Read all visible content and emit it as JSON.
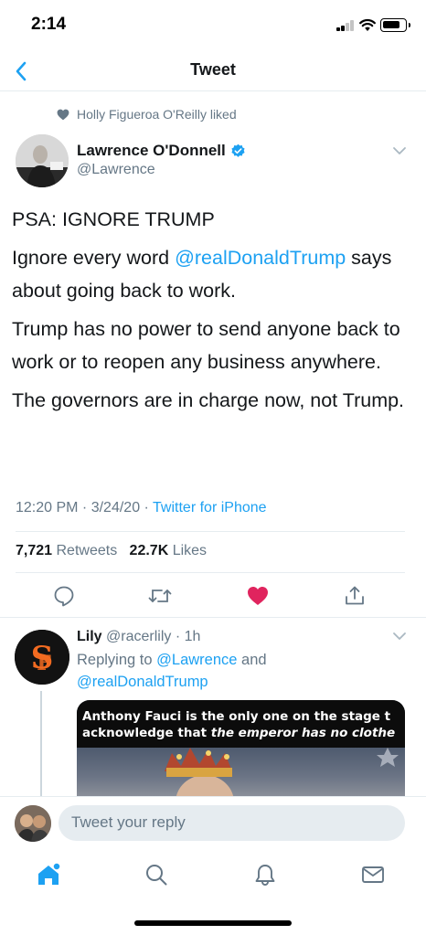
{
  "status_bar": {
    "time": "2:14"
  },
  "nav": {
    "title": "Tweet"
  },
  "social_context": {
    "text": "Holly Figueroa O'Reilly liked"
  },
  "tweet": {
    "author_name": "Lawrence O'Donnell",
    "author_handle": "@Lawrence",
    "paragraphs": {
      "p1": "PSA: IGNORE TRUMP",
      "p2_before": "Ignore every word ",
      "p2_mention": "@realDonaldTrump",
      "p2_after": " says about going back to work.",
      "p3": "Trump has no power to send anyone back to work or to reopen any business anywhere.",
      "p4": "The governors are in charge now, not Trump."
    },
    "time": "12:20 PM",
    "date": "3/24/20",
    "source": "Twitter for iPhone",
    "retweets_count": "7,721",
    "retweets_label": "Retweets",
    "likes_count": "22.7K",
    "likes_label": "Likes",
    "liked": true
  },
  "reply": {
    "name": "Lily",
    "handle": "@racerlily",
    "age": "1h",
    "replying_prefix": "Replying to ",
    "replying_to_1": "@Lawrence",
    "replying_and": " and",
    "replying_to_2": "@realDonaldTrump",
    "media_caption_line1": "Anthony Fauci is the only one on the stage t",
    "media_caption_line2_plain": "acknowledge that ",
    "media_caption_line2_italic": "the emperor has no clothe"
  },
  "composer": {
    "placeholder": "Tweet your reply"
  },
  "colors": {
    "accent": "#1da1f2",
    "like": "#e0245e",
    "secondary_text": "#657786",
    "divider": "#e6ecf0"
  },
  "icons": {
    "back": "chevron-left-icon",
    "liked_by": "heart-icon",
    "verified": "verified-badge-icon",
    "more": "chevron-down-icon",
    "reply": "comment-icon",
    "retweet": "retweet-icon",
    "like": "heart-filled-icon",
    "share": "share-icon",
    "tabs": [
      "home-icon",
      "search-icon",
      "bell-icon",
      "mail-icon"
    ]
  }
}
